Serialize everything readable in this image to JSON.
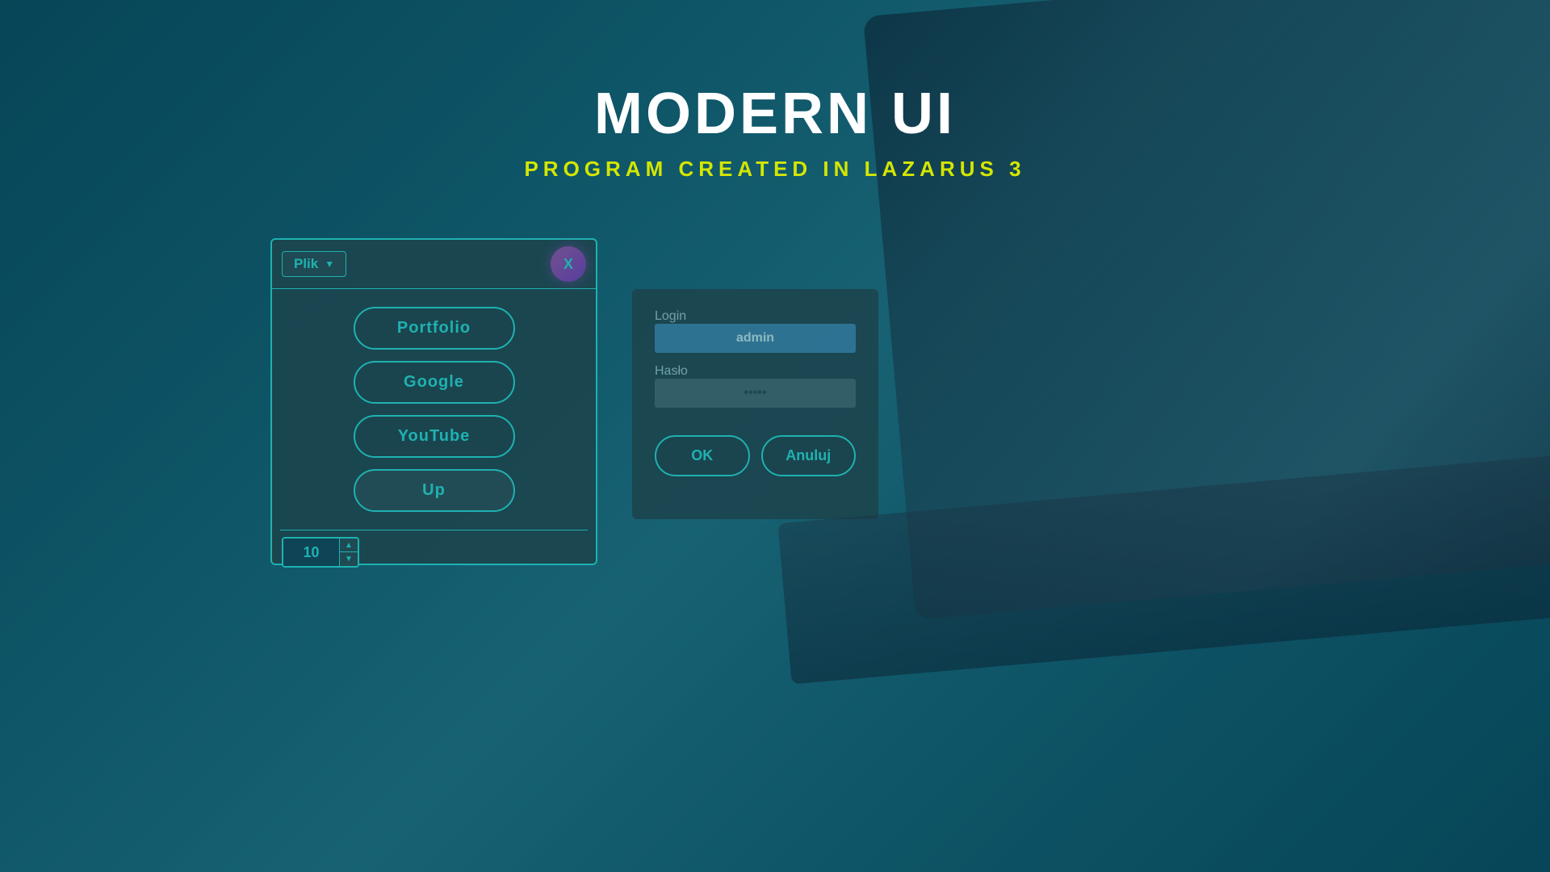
{
  "background": {
    "color": "#1a3a4a"
  },
  "header": {
    "main_title": "MODERN UI",
    "subtitle": "PROGRAM CREATED IN LAZARUS 3"
  },
  "main_panel": {
    "menu_label": "Plik",
    "close_label": "X",
    "buttons": [
      {
        "label": "Portfolio",
        "id": "portfolio"
      },
      {
        "label": "Google",
        "id": "google"
      },
      {
        "label": "YouTube",
        "id": "youtube"
      },
      {
        "label": "Up",
        "id": "up"
      }
    ],
    "spinner": {
      "value": "10",
      "arrow_up": "▲",
      "arrow_down": "▼"
    }
  },
  "login_panel": {
    "login_label": "Login",
    "login_value": "admin",
    "password_label": "Hasło",
    "password_value": "admin",
    "ok_label": "OK",
    "cancel_label": "Anuluj"
  },
  "colors": {
    "accent": "#3af0e0",
    "yellow": "#d4e600",
    "panel_bg": "rgba(50,45,45,0.92)",
    "close_gradient": "linear-gradient(135deg, #d040a0, #a020c0)"
  }
}
